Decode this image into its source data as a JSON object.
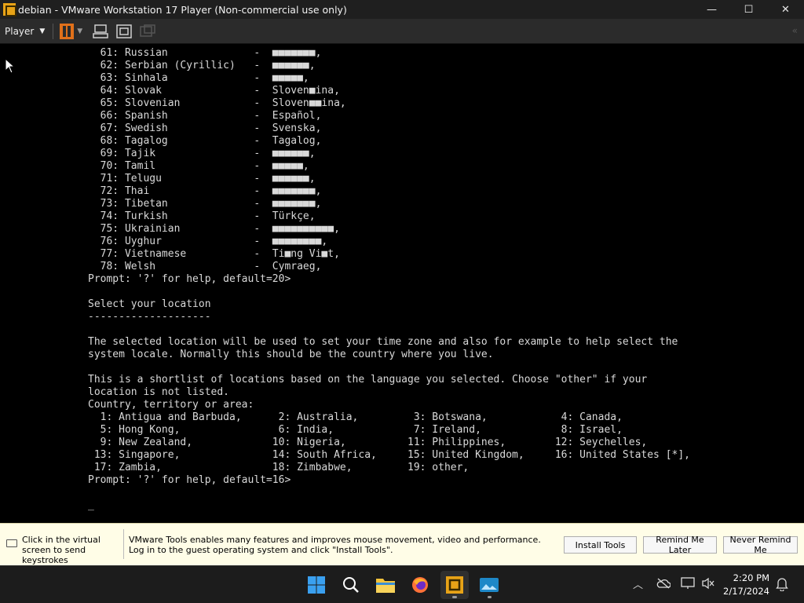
{
  "window": {
    "title": "debian - VMware Workstation 17 Player (Non-commercial use only)",
    "minimize": "—",
    "maximize": "☐",
    "close": "✕"
  },
  "toolbar": {
    "player_label": "Player",
    "collapse_label": "«"
  },
  "console": {
    "text": "  61: Russian              -  ■■■■■■■,\n  62: Serbian (Cyrillic)   -  ■■■■■■,\n  63: Sinhala              -  ■■■■■,\n  64: Slovak               -  Sloven■ina,\n  65: Slovenian            -  Sloven■■ina,\n  66: Spanish              -  Español,\n  67: Swedish              -  Svenska,\n  68: Tagalog              -  Tagalog,\n  69: Tajik                -  ■■■■■■,\n  70: Tamil                -  ■■■■■,\n  71: Telugu               -  ■■■■■■,\n  72: Thai                 -  ■■■■■■■,\n  73: Tibetan              -  ■■■■■■■,\n  74: Turkish              -  Türkçe,\n  75: Ukrainian            -  ■■■■■■■■■■,\n  76: Uyghur               -  ■■■■■■■■,\n  77: Vietnamese           -  Ti■ng Vi■t,\n  78: Welsh                -  Cymraeg,\nPrompt: '?' for help, default=20>\n\nSelect your location\n--------------------\n\nThe selected location will be used to set your time zone and also for example to help select the\nsystem locale. Normally this should be the country where you live.\n\nThis is a shortlist of locations based on the language you selected. Choose \"other\" if your\nlocation is not listed.\nCountry, territory or area:\n  1: Antigua and Barbuda,      2: Australia,         3: Botswana,            4: Canada,\n  5: Hong Kong,                6: India,             7: Ireland,             8: Israel,\n  9: New Zealand,             10: Nigeria,          11: Philippines,        12: Seychelles,\n 13: Singapore,               14: South Africa,     15: United Kingdom,     16: United States [*],\n 17: Zambia,                  18: Zimbabwe,         19: other,\nPrompt: '?' for help, default=16>\n\n_"
  },
  "notification": {
    "left_text": "Click in the virtual screen to send keystrokes",
    "message": "VMware Tools enables many features and improves mouse movement, video and performance. Log in to the guest operating system and click \"Install Tools\".",
    "install_button": "Install Tools",
    "remind_button": "Remind Me Later",
    "never_button": "Never Remind Me"
  },
  "taskbar": {
    "time": "2:20 PM",
    "date": "2/17/2024"
  },
  "colors": {
    "accent_orange": "#e0701a",
    "notification_bg": "#fffde7",
    "console_fg": "#d9d9d9"
  }
}
